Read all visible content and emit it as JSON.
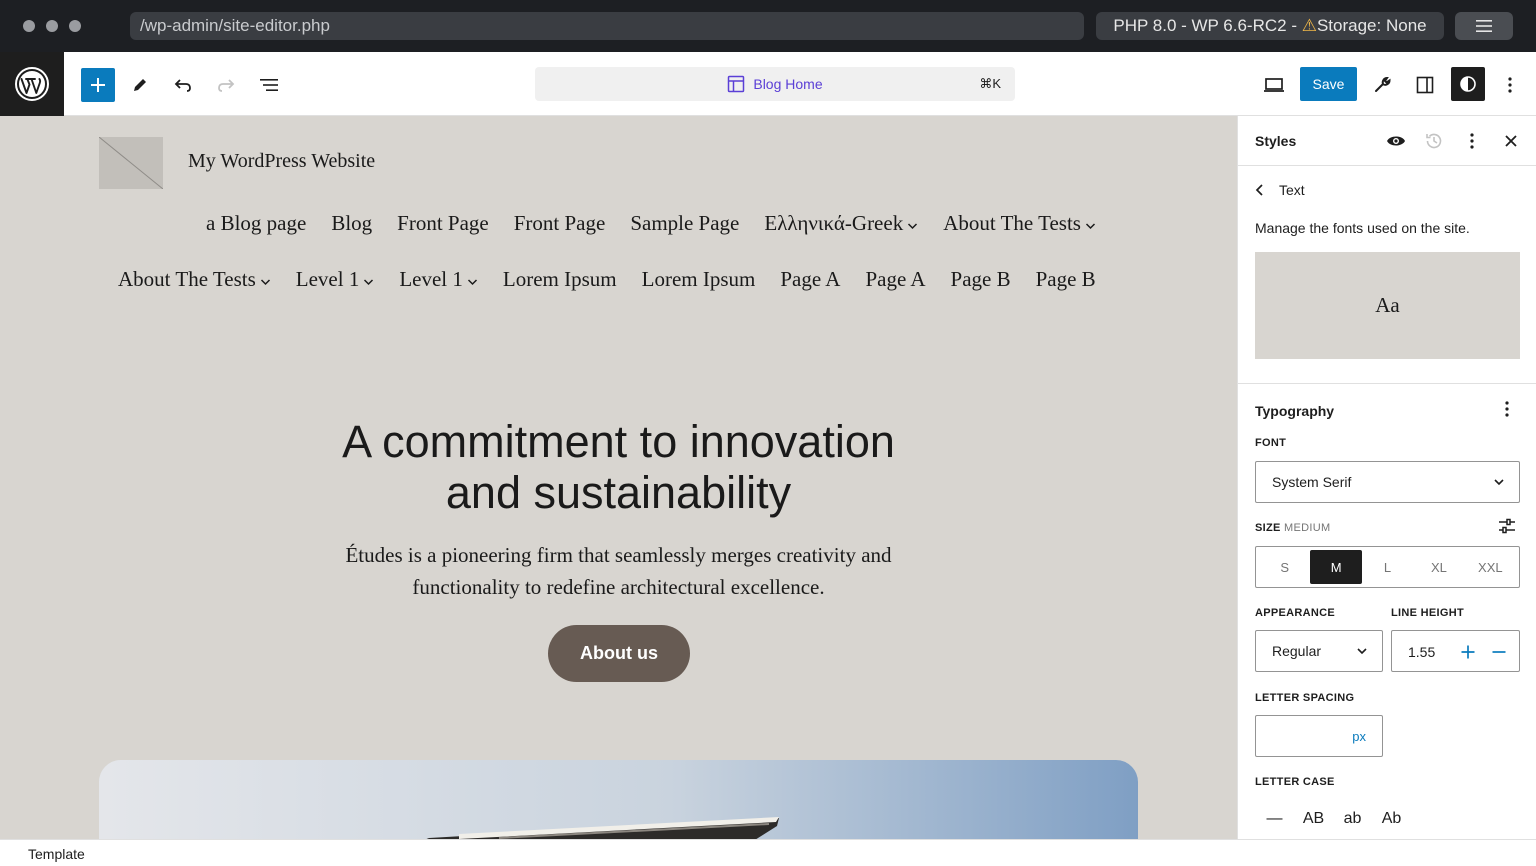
{
  "browser": {
    "url": "/wp-admin/site-editor.php",
    "env_prefix": "PHP 8.0 - WP 6.6-RC2 - ",
    "env_warning_icon": "⚠",
    "env_suffix": "Storage: None",
    "menu_icon": "hamburger-icon"
  },
  "toolbar": {
    "add_icon": "plus-icon",
    "tools_icon": "pencil-icon",
    "undo_icon": "undo-icon",
    "redo_icon": "redo-icon",
    "list_view_icon": "list-view-icon",
    "document_title": "Blog Home",
    "shortcut": "⌘K",
    "save_label": "Save",
    "accent": "#0a7bbd",
    "title_color": "#5b3fd6"
  },
  "canvas": {
    "site_title": "My WordPress Website",
    "nav_row1": [
      {
        "label": "a Blog page",
        "submenu": false
      },
      {
        "label": "Blog",
        "submenu": false
      },
      {
        "label": "Front Page",
        "submenu": false
      },
      {
        "label": "Front Page",
        "submenu": false
      },
      {
        "label": "Sample Page",
        "submenu": false
      },
      {
        "label": "Ελληνικά-Greek",
        "submenu": true
      },
      {
        "label": "About The Tests",
        "submenu": true
      }
    ],
    "nav_row2": [
      {
        "label": "About The Tests",
        "submenu": true
      },
      {
        "label": "Level 1",
        "submenu": true
      },
      {
        "label": "Level 1",
        "submenu": true
      },
      {
        "label": "Lorem Ipsum",
        "submenu": false
      },
      {
        "label": "Lorem Ipsum",
        "submenu": false
      },
      {
        "label": "Page A",
        "submenu": false
      },
      {
        "label": "Page A",
        "submenu": false
      },
      {
        "label": "Page B",
        "submenu": false
      },
      {
        "label": "Page B",
        "submenu": false
      }
    ],
    "hero_title_line1": "A commitment to innovation",
    "hero_title_line2": "and sustainability",
    "hero_desc_line1": "Études is a pioneering firm that seamlessly merges creativity and",
    "hero_desc_line2": "functionality to redefine architectural excellence.",
    "cta_label": "About us",
    "background": "#d8d5d0",
    "button_color": "#675b53"
  },
  "sidebar": {
    "title": "Styles",
    "back_label": "Text",
    "description": "Manage the fonts used on the site.",
    "preview_text": "Aa",
    "typography_title": "Typography",
    "font_label": "FONT",
    "font_value": "System Serif",
    "size_label": "SIZE",
    "size_sub": "MEDIUM",
    "size_options": [
      "S",
      "M",
      "L",
      "XL",
      "XXL"
    ],
    "size_selected": "M",
    "appearance_label": "APPEARANCE",
    "appearance_value": "Regular",
    "line_height_label": "LINE HEIGHT",
    "line_height_value": "1.55",
    "letter_spacing_label": "LETTER SPACING",
    "letter_spacing_unit": "px",
    "letter_case_label": "LETTER CASE",
    "letter_case_options": [
      "—",
      "AB",
      "ab",
      "Ab"
    ]
  },
  "footer": {
    "breadcrumb": "Template"
  }
}
